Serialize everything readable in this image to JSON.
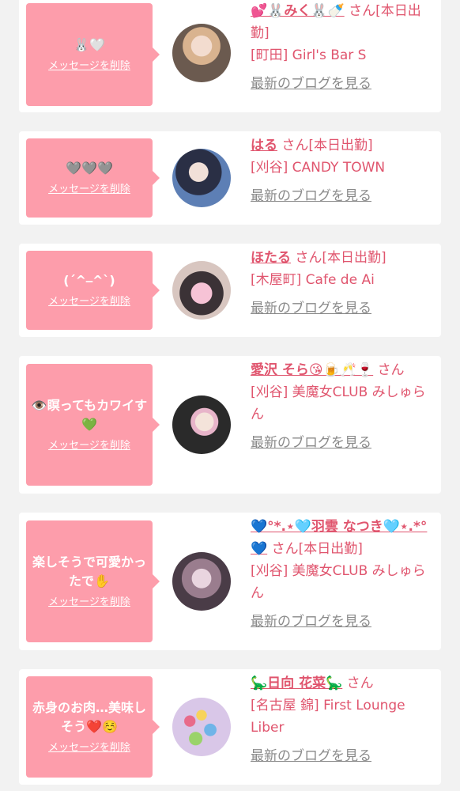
{
  "colors": {
    "bubble": "#fd9dab",
    "accent": "#e0556e",
    "blog_link": "#8a8a8a",
    "background": "#f2f2f2",
    "card": "#ffffff"
  },
  "delete_label": "メッセージを削除",
  "blog_label": "最新のブログを見る",
  "entries": [
    {
      "message": "🐰🤍",
      "name": "💕🐰みく🐰🍼",
      "suffix": "さん[本日出勤]",
      "shop": "[町田] Girl's Bar S",
      "avatar": "avatar-1"
    },
    {
      "message": "🩶🩶🩶",
      "name": "はる",
      "suffix": "さん[本日出勤]",
      "shop": "[刈谷] CANDY TOWN",
      "avatar": "avatar-2"
    },
    {
      "message": "(ˊ^⎯^ˋ)",
      "name": "ほたる",
      "suffix": "さん[本日出勤]",
      "shop": "[木屋町] Cafe de Ai",
      "avatar": "avatar-3"
    },
    {
      "message": "👁️瞑ってもカワイす💚",
      "name": "愛沢 そら😘🍺🥂🍷",
      "suffix": "さん",
      "shop": "[刈谷] 美魔女CLUB みしゅらん",
      "avatar": "avatar-4"
    },
    {
      "message": "楽しそうで可愛かったで✋",
      "name": "💙°*.⋆🩵羽雲 なつき🩵⋆.*°💙",
      "suffix": "さん[本日出勤]",
      "shop": "[刈谷] 美魔女CLUB みしゅらん",
      "avatar": "avatar-5"
    },
    {
      "message": "赤身のお肉…美味しそう❤️☺️",
      "name": "🦕日向 花菜🦕",
      "suffix": "さん",
      "shop": "[名古屋 錦] First Lounge Liber",
      "avatar": "avatar-6"
    }
  ]
}
